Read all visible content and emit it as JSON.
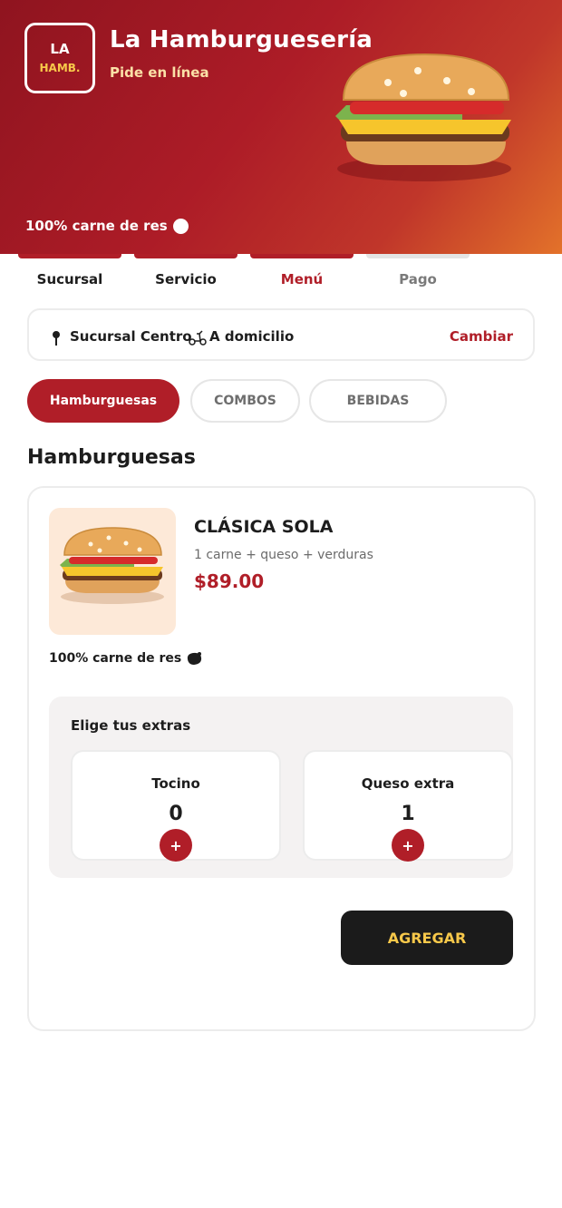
{
  "brand": {
    "logo_line1": "LA",
    "logo_line2": "HAMB.",
    "title": "La Hamburguesería",
    "subtitle": "Pide en línea",
    "tagline": "100% carne de res"
  },
  "steps": [
    {
      "label": "Sucursal",
      "state": "done"
    },
    {
      "label": "Servicio",
      "state": "done"
    },
    {
      "label": "Menú",
      "state": "active"
    },
    {
      "label": "Pago",
      "state": "pending"
    }
  ],
  "branch": {
    "name": "Sucursal Centro",
    "mode": "A domicilio",
    "change_label": "Cambiar"
  },
  "categories": [
    {
      "label": "Hamburguesas",
      "active": true
    },
    {
      "label": "COMBOS",
      "active": false
    },
    {
      "label": "BEBIDAS",
      "active": false
    }
  ],
  "section_title": "Hamburguesas",
  "product": {
    "name": "CLÁSICA SOLA",
    "description": "1 carne + queso + verduras",
    "price": "$89.00",
    "tag": "100% carne de res",
    "extras_title": "Elige tus extras",
    "extras": [
      {
        "name": "Tocino",
        "count": "0",
        "add_label": "+"
      },
      {
        "name": "Queso extra",
        "count": "1",
        "add_label": "+"
      }
    ],
    "add_button_label": "AGREGAR"
  },
  "colors": {
    "accent": "#b01e28",
    "gold": "#f7c84a",
    "dark": "#1b1b1b"
  },
  "icons": [
    "burger-illustration-icon",
    "location-pin-icon",
    "scooter-icon",
    "meat-icon",
    "plus-icon"
  ]
}
